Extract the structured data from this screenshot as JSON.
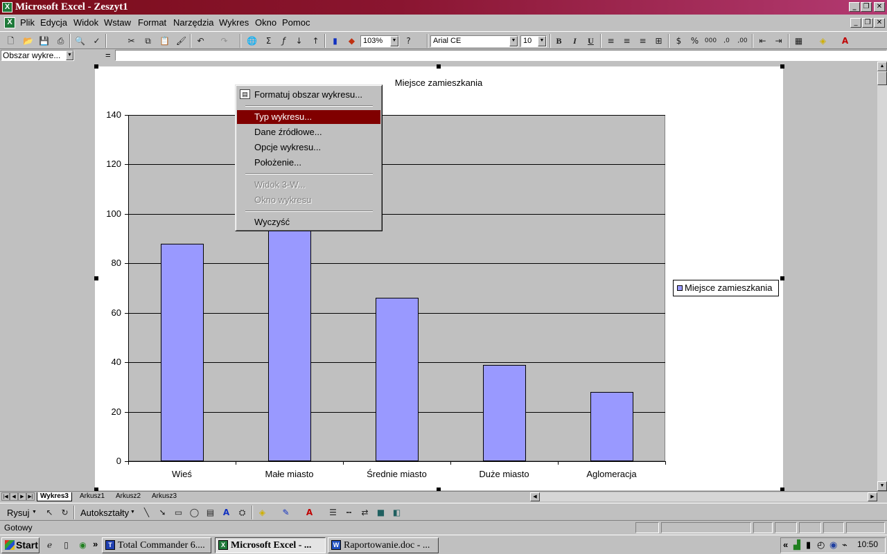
{
  "window": {
    "title": "Microsoft Excel - Zeszyt1",
    "min": "_",
    "max": "❐",
    "close": "✕"
  },
  "menu": [
    "Plik",
    "Edycja",
    "Widok",
    "Wstaw",
    "Format",
    "Narzędzia",
    "Wykres",
    "Okno",
    "Pomoc"
  ],
  "toolbar": {
    "zoom": "103%",
    "font": "Arial CE",
    "size": "10",
    "bold": "B",
    "italic": "I",
    "underline": "U"
  },
  "formula_bar": {
    "name_box": "Obszar wykre...",
    "equals": "="
  },
  "chart_data": {
    "type": "bar",
    "title": "Miejsce zamieszkania",
    "categories": [
      "Wieś",
      "Małe miasto",
      "Średnie miasto",
      "Duże miasto",
      "Aglomeracja"
    ],
    "series": [
      {
        "name": "Miejsce zamieszkania",
        "values": [
          88,
          100,
          66,
          39,
          28
        ],
        "color": "#9999ff"
      }
    ],
    "ylim": [
      0,
      140
    ],
    "yticks": [
      "0",
      "20",
      "40",
      "60",
      "80",
      "100",
      "120",
      "140"
    ],
    "grid": true,
    "legend": "right",
    "plot_bg": "#c0c0c0"
  },
  "context_menu": {
    "items": [
      "Formatuj obszar wykresu...",
      "Typ wykresu...",
      "Dane źródłowe...",
      "Opcje wykresu...",
      "Położenie...",
      "Widok 3-W...",
      "Okno wykresu",
      "Wyczyść"
    ],
    "selected": "Typ wykresu...",
    "disabled": [
      "Widok 3-W...",
      "Okno wykresu"
    ]
  },
  "sheet_tabs": [
    "Wykres3",
    "Arkusz1",
    "Arkusz2",
    "Arkusz3"
  ],
  "active_tab": "Wykres3",
  "drawing_toolbar": {
    "draw": "Rysuj",
    "autoshapes": "Autokształty"
  },
  "status": {
    "text": "Gotowy"
  },
  "taskbar": {
    "start": "Start",
    "tasks": [
      "Total Commander 6....",
      "Microsoft Excel - ...",
      "Raportowanie.doc - ..."
    ],
    "clock": "10:50"
  }
}
